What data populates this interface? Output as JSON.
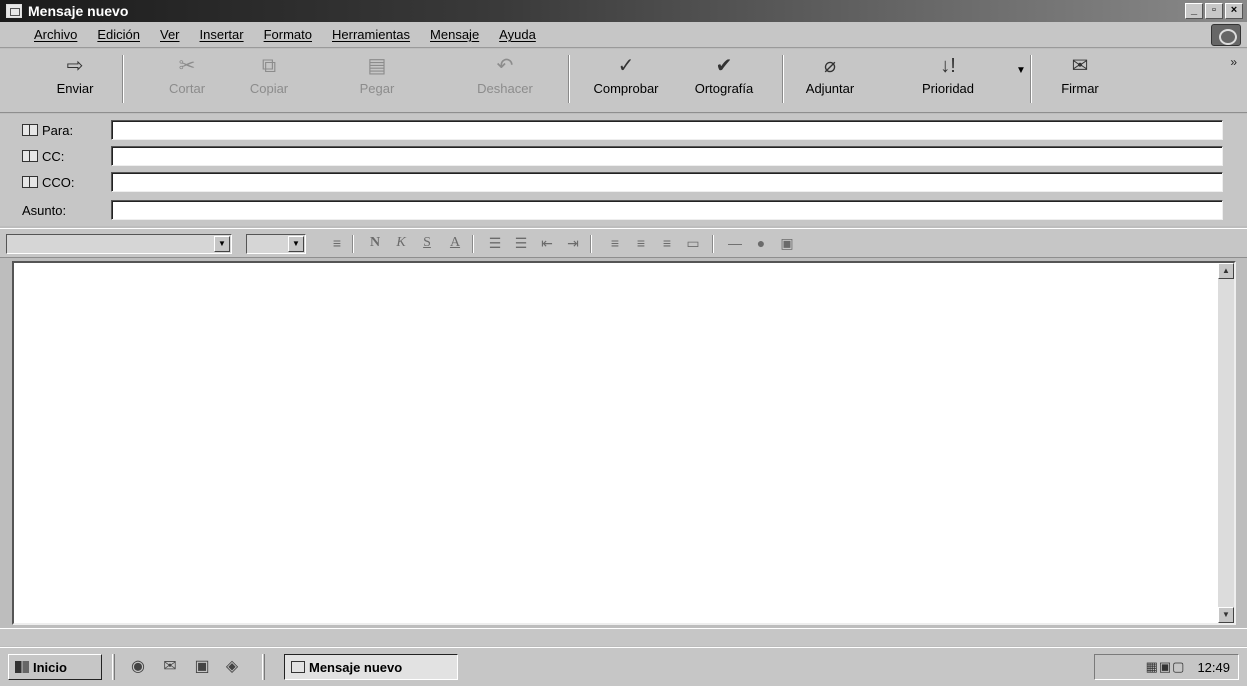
{
  "window": {
    "title": "Mensaje nuevo",
    "controls": [
      "_",
      "▫",
      "×"
    ]
  },
  "menu": [
    "Archivo",
    "Edición",
    "Ver",
    "Insertar",
    "Formato",
    "Herramientas",
    "Mensaje",
    "Ayuda"
  ],
  "toolbar": {
    "send": "Enviar",
    "cut": "Cortar",
    "copy": "Copiar",
    "paste": "Pegar",
    "undo": "Deshacer",
    "check": "Comprobar",
    "spelling": "Ortografía",
    "attach": "Adjuntar",
    "priority": "Prioridad",
    "sign": "Firmar"
  },
  "fields": {
    "to_label": "Para:",
    "cc_label": "CC:",
    "bcc_label": "CCO:",
    "subject_label": "Asunto:",
    "to_value": "",
    "cc_value": "",
    "bcc_value": "",
    "subject_value": ""
  },
  "format": {
    "bold": "N",
    "italic": "K",
    "underline": "S",
    "font_color": "A"
  },
  "taskbar": {
    "start_label": "Inicio",
    "task_label": "Mensaje nuevo",
    "clock": "12:49"
  },
  "colors": {
    "face": "#c6c6c6",
    "title_bar": "#1b1b1b"
  }
}
